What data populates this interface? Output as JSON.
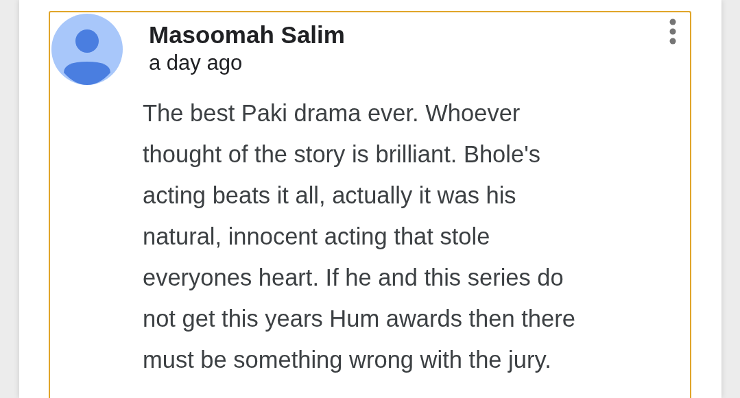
{
  "comment": {
    "author": "Masoomah Salim",
    "time": "a day ago",
    "body_lines": [
      "The best Paki drama ever. Whoever",
      "thought of the story is brilliant. Bhole's",
      "acting beats it all, actually it was his",
      "natural, innocent acting that stole",
      "everyones heart. If he and this series do",
      "not get this years Hum awards then there",
      "must be something wrong with the jury."
    ]
  }
}
